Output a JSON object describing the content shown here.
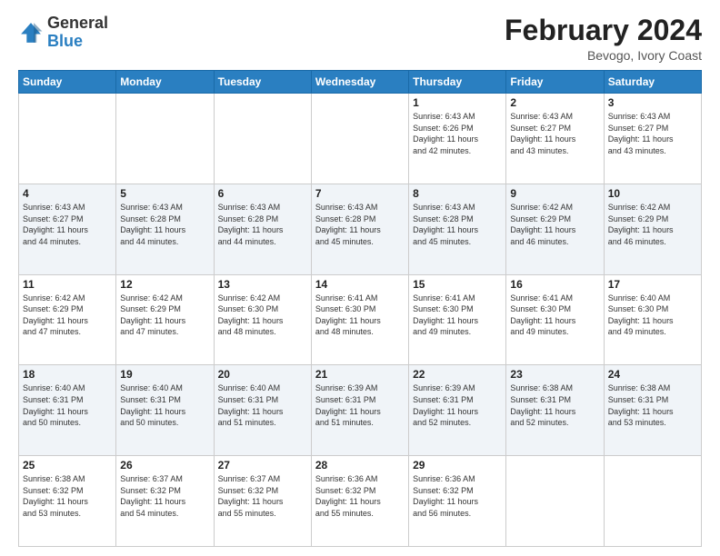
{
  "header": {
    "logo_general": "General",
    "logo_blue": "Blue",
    "month_title": "February 2024",
    "location": "Bevogo, Ivory Coast"
  },
  "days_of_week": [
    "Sunday",
    "Monday",
    "Tuesday",
    "Wednesday",
    "Thursday",
    "Friday",
    "Saturday"
  ],
  "weeks": [
    [
      {
        "day": "",
        "info": ""
      },
      {
        "day": "",
        "info": ""
      },
      {
        "day": "",
        "info": ""
      },
      {
        "day": "",
        "info": ""
      },
      {
        "day": "1",
        "info": "Sunrise: 6:43 AM\nSunset: 6:26 PM\nDaylight: 11 hours\nand 42 minutes."
      },
      {
        "day": "2",
        "info": "Sunrise: 6:43 AM\nSunset: 6:27 PM\nDaylight: 11 hours\nand 43 minutes."
      },
      {
        "day": "3",
        "info": "Sunrise: 6:43 AM\nSunset: 6:27 PM\nDaylight: 11 hours\nand 43 minutes."
      }
    ],
    [
      {
        "day": "4",
        "info": "Sunrise: 6:43 AM\nSunset: 6:27 PM\nDaylight: 11 hours\nand 44 minutes."
      },
      {
        "day": "5",
        "info": "Sunrise: 6:43 AM\nSunset: 6:28 PM\nDaylight: 11 hours\nand 44 minutes."
      },
      {
        "day": "6",
        "info": "Sunrise: 6:43 AM\nSunset: 6:28 PM\nDaylight: 11 hours\nand 44 minutes."
      },
      {
        "day": "7",
        "info": "Sunrise: 6:43 AM\nSunset: 6:28 PM\nDaylight: 11 hours\nand 45 minutes."
      },
      {
        "day": "8",
        "info": "Sunrise: 6:43 AM\nSunset: 6:28 PM\nDaylight: 11 hours\nand 45 minutes."
      },
      {
        "day": "9",
        "info": "Sunrise: 6:42 AM\nSunset: 6:29 PM\nDaylight: 11 hours\nand 46 minutes."
      },
      {
        "day": "10",
        "info": "Sunrise: 6:42 AM\nSunset: 6:29 PM\nDaylight: 11 hours\nand 46 minutes."
      }
    ],
    [
      {
        "day": "11",
        "info": "Sunrise: 6:42 AM\nSunset: 6:29 PM\nDaylight: 11 hours\nand 47 minutes."
      },
      {
        "day": "12",
        "info": "Sunrise: 6:42 AM\nSunset: 6:29 PM\nDaylight: 11 hours\nand 47 minutes."
      },
      {
        "day": "13",
        "info": "Sunrise: 6:42 AM\nSunset: 6:30 PM\nDaylight: 11 hours\nand 48 minutes."
      },
      {
        "day": "14",
        "info": "Sunrise: 6:41 AM\nSunset: 6:30 PM\nDaylight: 11 hours\nand 48 minutes."
      },
      {
        "day": "15",
        "info": "Sunrise: 6:41 AM\nSunset: 6:30 PM\nDaylight: 11 hours\nand 49 minutes."
      },
      {
        "day": "16",
        "info": "Sunrise: 6:41 AM\nSunset: 6:30 PM\nDaylight: 11 hours\nand 49 minutes."
      },
      {
        "day": "17",
        "info": "Sunrise: 6:40 AM\nSunset: 6:30 PM\nDaylight: 11 hours\nand 49 minutes."
      }
    ],
    [
      {
        "day": "18",
        "info": "Sunrise: 6:40 AM\nSunset: 6:31 PM\nDaylight: 11 hours\nand 50 minutes."
      },
      {
        "day": "19",
        "info": "Sunrise: 6:40 AM\nSunset: 6:31 PM\nDaylight: 11 hours\nand 50 minutes."
      },
      {
        "day": "20",
        "info": "Sunrise: 6:40 AM\nSunset: 6:31 PM\nDaylight: 11 hours\nand 51 minutes."
      },
      {
        "day": "21",
        "info": "Sunrise: 6:39 AM\nSunset: 6:31 PM\nDaylight: 11 hours\nand 51 minutes."
      },
      {
        "day": "22",
        "info": "Sunrise: 6:39 AM\nSunset: 6:31 PM\nDaylight: 11 hours\nand 52 minutes."
      },
      {
        "day": "23",
        "info": "Sunrise: 6:38 AM\nSunset: 6:31 PM\nDaylight: 11 hours\nand 52 minutes."
      },
      {
        "day": "24",
        "info": "Sunrise: 6:38 AM\nSunset: 6:31 PM\nDaylight: 11 hours\nand 53 minutes."
      }
    ],
    [
      {
        "day": "25",
        "info": "Sunrise: 6:38 AM\nSunset: 6:32 PM\nDaylight: 11 hours\nand 53 minutes."
      },
      {
        "day": "26",
        "info": "Sunrise: 6:37 AM\nSunset: 6:32 PM\nDaylight: 11 hours\nand 54 minutes."
      },
      {
        "day": "27",
        "info": "Sunrise: 6:37 AM\nSunset: 6:32 PM\nDaylight: 11 hours\nand 55 minutes."
      },
      {
        "day": "28",
        "info": "Sunrise: 6:36 AM\nSunset: 6:32 PM\nDaylight: 11 hours\nand 55 minutes."
      },
      {
        "day": "29",
        "info": "Sunrise: 6:36 AM\nSunset: 6:32 PM\nDaylight: 11 hours\nand 56 minutes."
      },
      {
        "day": "",
        "info": ""
      },
      {
        "day": "",
        "info": ""
      }
    ]
  ]
}
